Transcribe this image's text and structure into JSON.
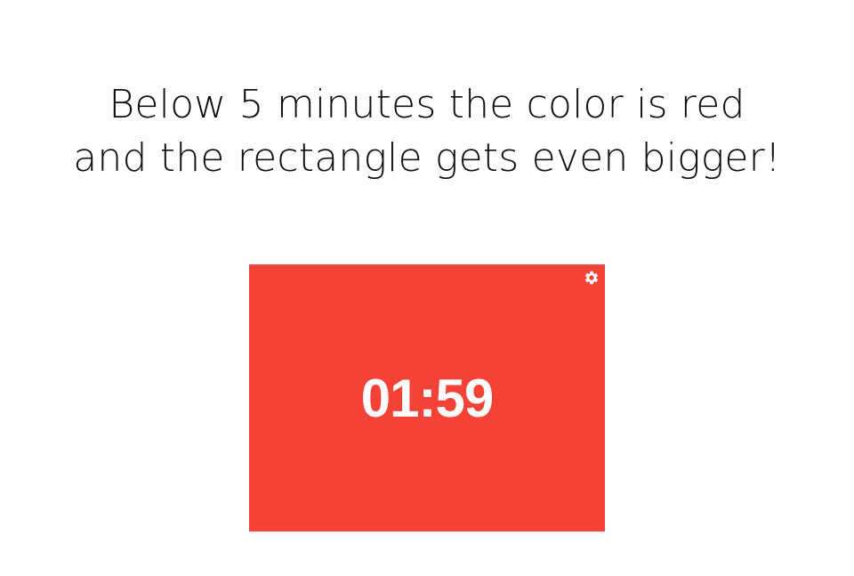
{
  "headline": {
    "line1": "Below 5 minutes the color is red",
    "line2": "and the rectangle gets even bigger!"
  },
  "timer": {
    "time": "01:59",
    "background_color": "#f44336",
    "text_color": "#ffffff",
    "settings_icon": "gear-icon"
  }
}
